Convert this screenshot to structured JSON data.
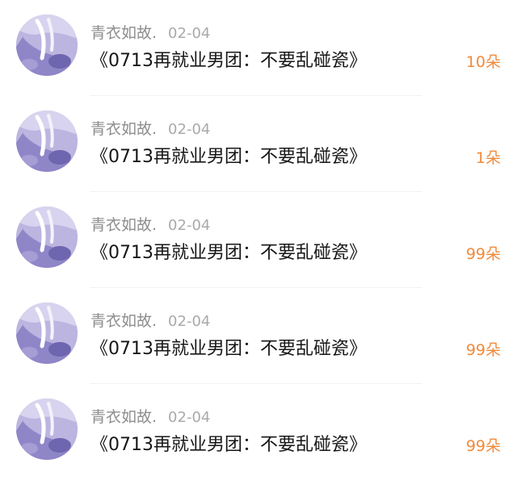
{
  "comments": [
    {
      "user": "青衣如故.",
      "date": "02-04",
      "title": "《0713再就业男团：不要乱碰瓷》",
      "flowers": "10朵"
    },
    {
      "user": "青衣如故.",
      "date": "02-04",
      "title": "《0713再就业男团：不要乱碰瓷》",
      "flowers": "1朵"
    },
    {
      "user": "青衣如故.",
      "date": "02-04",
      "title": "《0713再就业男团：不要乱碰瓷》",
      "flowers": "99朵"
    },
    {
      "user": "青衣如故.",
      "date": "02-04",
      "title": "《0713再就业男团：不要乱碰瓷》",
      "flowers": "99朵"
    },
    {
      "user": "青衣如故.",
      "date": "02-04",
      "title": "《0713再就业男团：不要乱碰瓷》",
      "flowers": "99朵"
    }
  ],
  "colors": {
    "accent": "#f08a3c",
    "name": "#8e8e8e",
    "date": "#a9a9a9",
    "title": "#161616",
    "avatar_bg": "#b9b1de"
  },
  "icons": {
    "avatar": "avatar-illustration"
  }
}
